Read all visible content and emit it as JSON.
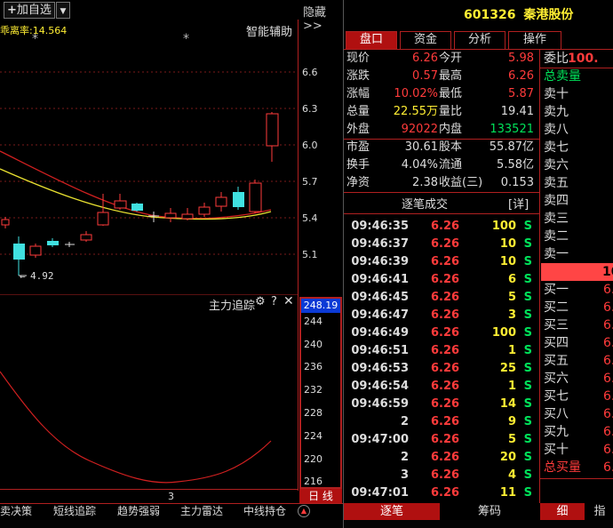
{
  "toolbar": {
    "add_watchlist": "加自选",
    "hide_label": "隐藏>>"
  },
  "indicator": {
    "deviation_label": "乖离率:14.564",
    "smart_assist": "智能辅助",
    "low_marker": "4.92"
  },
  "price_axis": [
    "6.6",
    "6.3",
    "6.0",
    "5.7",
    "5.4",
    "5.1"
  ],
  "sub_chart": {
    "title": "主力追踪",
    "current_value": "248.19",
    "axis": [
      "244",
      "240",
      "236",
      "232",
      "228",
      "224",
      "220",
      "216"
    ],
    "x_label": "3",
    "period": "日 线"
  },
  "bottom_tabs": [
    "卖决策",
    "短线追踪",
    "趋势强弱",
    "主力雷达",
    "中线持仓"
  ],
  "stock": {
    "code": "601326",
    "name": "秦港股份"
  },
  "tabs": [
    "盘口",
    "资金",
    "分析",
    "操作"
  ],
  "quote": {
    "rows1": [
      {
        "l1": "现价",
        "v1": "6.26",
        "l2": "今开",
        "v2": "5.98"
      },
      {
        "l1": "涨跌",
        "v1": "0.57",
        "l2": "最高",
        "v2": "6.26"
      },
      {
        "l1": "涨幅",
        "v1": "10.02%",
        "l2": "最低",
        "v2": "5.87"
      },
      {
        "l1": "总量",
        "v1": "22.55万",
        "l2": "量比",
        "v2": "19.41"
      },
      {
        "l1": "外盘",
        "v1": "92022",
        "l2": "内盘",
        "v2": "133521"
      }
    ],
    "rows2": [
      {
        "l1": "市盈",
        "v1": "30.61",
        "l2": "股本",
        "v2": "55.87亿"
      },
      {
        "l1": "换手",
        "v1": "4.04%",
        "l2": "流通",
        "v2": "5.58亿"
      },
      {
        "l1": "净资",
        "v1": "2.38",
        "l2": "收益(三)",
        "v2": "0.153"
      }
    ]
  },
  "trades_header": {
    "title": "逐笔成交",
    "detail": "[详]"
  },
  "trades": [
    {
      "t": "09:46:35",
      "p": "6.26",
      "v": "100",
      "s": "S"
    },
    {
      "t": "09:46:37",
      "p": "6.26",
      "v": "10",
      "s": "S"
    },
    {
      "t": "09:46:39",
      "p": "6.26",
      "v": "10",
      "s": "S"
    },
    {
      "t": "09:46:41",
      "p": "6.26",
      "v": "6",
      "s": "S"
    },
    {
      "t": "09:46:45",
      "p": "6.26",
      "v": "5",
      "s": "S"
    },
    {
      "t": "09:46:47",
      "p": "6.26",
      "v": "3",
      "s": "S"
    },
    {
      "t": "09:46:49",
      "p": "6.26",
      "v": "100",
      "s": "S"
    },
    {
      "t": "09:46:51",
      "p": "6.26",
      "v": "1",
      "s": "S"
    },
    {
      "t": "09:46:53",
      "p": "6.26",
      "v": "25",
      "s": "S"
    },
    {
      "t": "09:46:54",
      "p": "6.26",
      "v": "1",
      "s": "S"
    },
    {
      "t": "09:46:59",
      "p": "6.26",
      "v": "14",
      "s": "S"
    },
    {
      "t": "2",
      "p": "6.26",
      "v": "9",
      "s": "S"
    },
    {
      "t": "09:47:00",
      "p": "6.26",
      "v": "5",
      "s": "S"
    },
    {
      "t": "2",
      "p": "6.26",
      "v": "20",
      "s": "S"
    },
    {
      "t": "3",
      "p": "6.26",
      "v": "4",
      "s": "S"
    },
    {
      "t": "09:47:01",
      "p": "6.26",
      "v": "11",
      "s": "S"
    }
  ],
  "right_bottom_tabs": [
    "逐笔",
    "筹码",
    "细",
    "指"
  ],
  "orderbook": {
    "ratio_label": "委比",
    "ratio_value": "100.",
    "sell_total": "总卖量",
    "sells": [
      "卖十",
      "卖九",
      "卖八",
      "卖七",
      "卖六",
      "卖五",
      "卖四",
      "卖三",
      "卖二",
      "卖一"
    ],
    "limit_value": "10",
    "buys": [
      "买一",
      "买二",
      "买三",
      "买四",
      "买五",
      "买六",
      "买七",
      "买八",
      "买九",
      "买十"
    ],
    "buy_prices": [
      "6.",
      "6.",
      "6.",
      "6.",
      "6.",
      "6.",
      "6.",
      "6.",
      "6.",
      "6."
    ],
    "buy_total": "总买量",
    "buy_total_value": "6."
  }
}
